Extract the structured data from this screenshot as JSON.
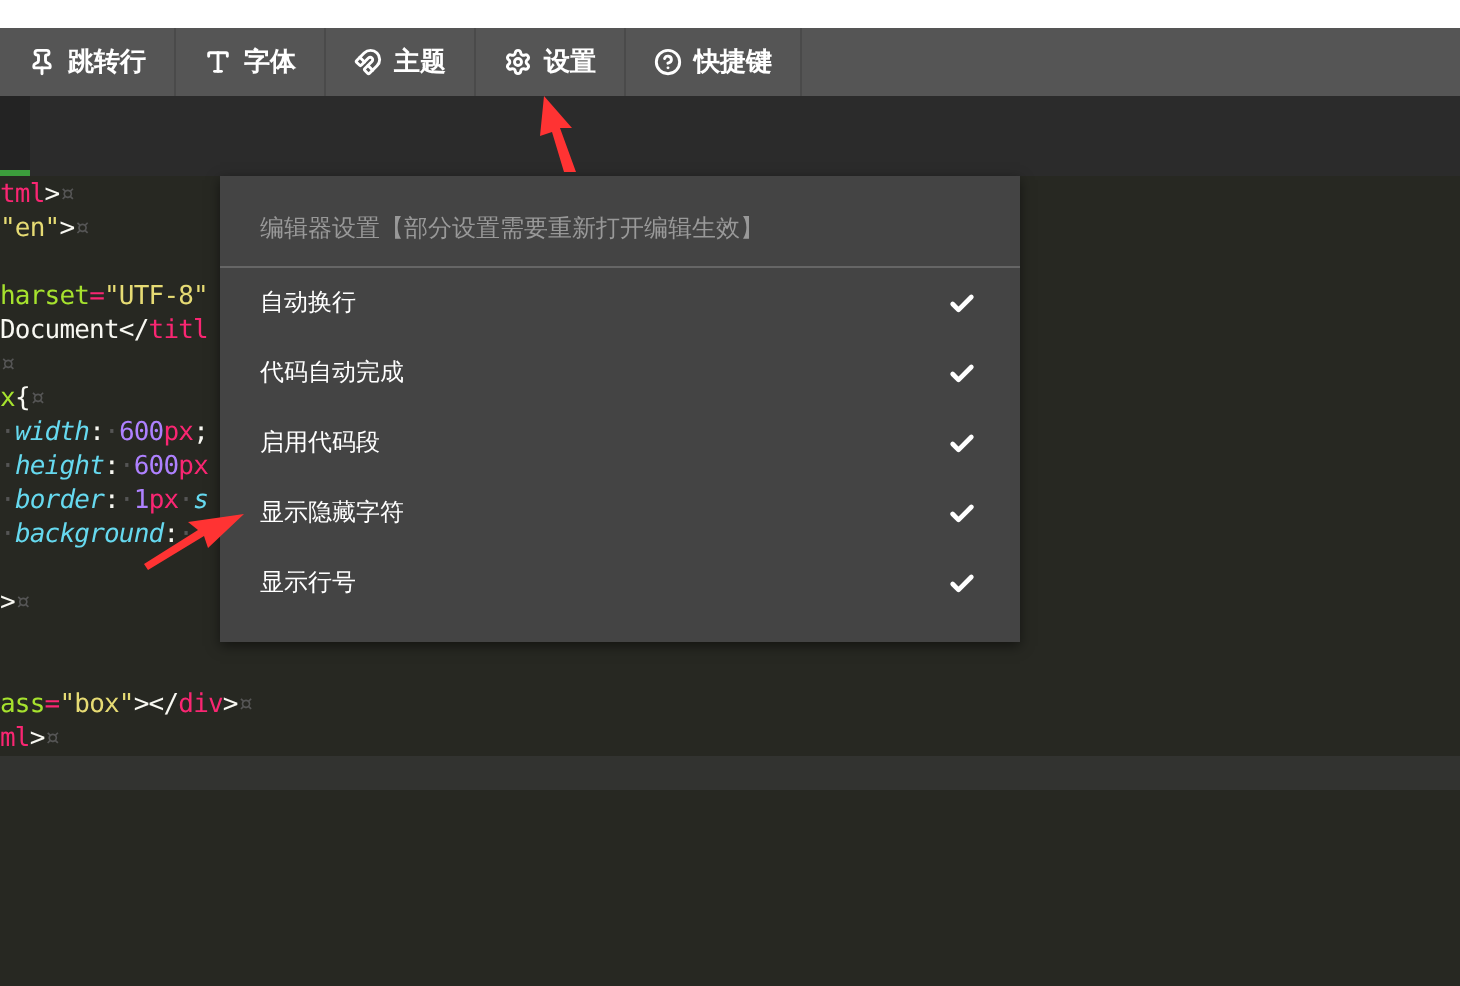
{
  "toolbar": [
    {
      "label": "跳转行"
    },
    {
      "label": "字体"
    },
    {
      "label": "主题"
    },
    {
      "label": "设置"
    },
    {
      "label": "快捷键"
    }
  ],
  "code_lines": [
    {
      "kind": "code",
      "tokens": [
        {
          "kind": "tag",
          "text": "tml"
        },
        {
          "kind": "punct",
          "text": ">"
        },
        {
          "kind": "ws",
          "text": "¤"
        }
      ]
    },
    {
      "kind": "code",
      "tokens": [
        {
          "kind": "string",
          "text": "\"en\""
        },
        {
          "kind": "punct",
          "text": ">"
        },
        {
          "kind": "ws",
          "text": "¤"
        }
      ]
    },
    {
      "kind": "blank"
    },
    {
      "kind": "code",
      "tokens": [
        {
          "kind": "attr",
          "text": "harset"
        },
        {
          "kind": "tag",
          "text": "="
        },
        {
          "kind": "string",
          "text": "\"UTF-8\""
        }
      ]
    },
    {
      "kind": "code",
      "tokens": [
        {
          "kind": "plain",
          "text": "Document</"
        },
        {
          "kind": "tag",
          "text": "titl"
        }
      ]
    },
    {
      "kind": "code",
      "tokens": [
        {
          "kind": "ws",
          "text": "¤"
        }
      ]
    },
    {
      "kind": "code",
      "tokens": [
        {
          "kind": "attr",
          "text": "x"
        },
        {
          "kind": "plain",
          "text": "{"
        },
        {
          "kind": "ws",
          "text": "¤"
        }
      ]
    },
    {
      "kind": "code",
      "tokens": [
        {
          "kind": "ws",
          "text": "·"
        },
        {
          "kind": "prop",
          "text": "width"
        },
        {
          "kind": "plain",
          "text": ":"
        },
        {
          "kind": "ws",
          "text": "·"
        },
        {
          "kind": "number",
          "text": "600"
        },
        {
          "kind": "tag",
          "text": "px"
        },
        {
          "kind": "plain",
          "text": ";"
        }
      ]
    },
    {
      "kind": "code",
      "tokens": [
        {
          "kind": "ws",
          "text": "·"
        },
        {
          "kind": "prop",
          "text": "height"
        },
        {
          "kind": "plain",
          "text": ":"
        },
        {
          "kind": "ws",
          "text": "·"
        },
        {
          "kind": "number",
          "text": "600"
        },
        {
          "kind": "tag",
          "text": "px"
        }
      ]
    },
    {
      "kind": "code",
      "tokens": [
        {
          "kind": "ws",
          "text": "·"
        },
        {
          "kind": "prop",
          "text": "border"
        },
        {
          "kind": "plain",
          "text": ":"
        },
        {
          "kind": "ws",
          "text": "·"
        },
        {
          "kind": "number",
          "text": "1"
        },
        {
          "kind": "tag",
          "text": "px"
        },
        {
          "kind": "ws",
          "text": "·"
        },
        {
          "kind": "prop",
          "text": "s"
        }
      ]
    },
    {
      "kind": "code",
      "tokens": [
        {
          "kind": "ws",
          "text": "·"
        },
        {
          "kind": "prop",
          "text": "background"
        },
        {
          "kind": "plain",
          "text": ":"
        },
        {
          "kind": "ws",
          "text": "·"
        }
      ]
    },
    {
      "kind": "blank"
    },
    {
      "kind": "code",
      "tokens": [
        {
          "kind": "plain",
          "text": ">"
        },
        {
          "kind": "ws",
          "text": "¤"
        }
      ]
    },
    {
      "kind": "blank"
    },
    {
      "kind": "blank"
    },
    {
      "kind": "code",
      "tokens": [
        {
          "kind": "attr",
          "text": "ass"
        },
        {
          "kind": "tag",
          "text": "="
        },
        {
          "kind": "string",
          "text": "\"box\""
        },
        {
          "kind": "plain",
          "text": "></"
        },
        {
          "kind": "tag",
          "text": "div"
        },
        {
          "kind": "plain",
          "text": ">"
        },
        {
          "kind": "ws",
          "text": "¤"
        }
      ]
    },
    {
      "kind": "code",
      "tokens": [
        {
          "kind": "tag",
          "text": "ml"
        },
        {
          "kind": "plain",
          "text": ">"
        },
        {
          "kind": "ws",
          "text": "¤"
        }
      ]
    }
  ],
  "settings_menu": {
    "title": "编辑器设置【部分设置需要重新打开编辑生效】",
    "items": [
      {
        "label": "自动换行",
        "checked": true
      },
      {
        "label": "代码自动完成",
        "checked": true
      },
      {
        "label": "启用代码段",
        "checked": true
      },
      {
        "label": "显示隐藏字符",
        "checked": true
      },
      {
        "label": "显示行号",
        "checked": true
      }
    ]
  }
}
